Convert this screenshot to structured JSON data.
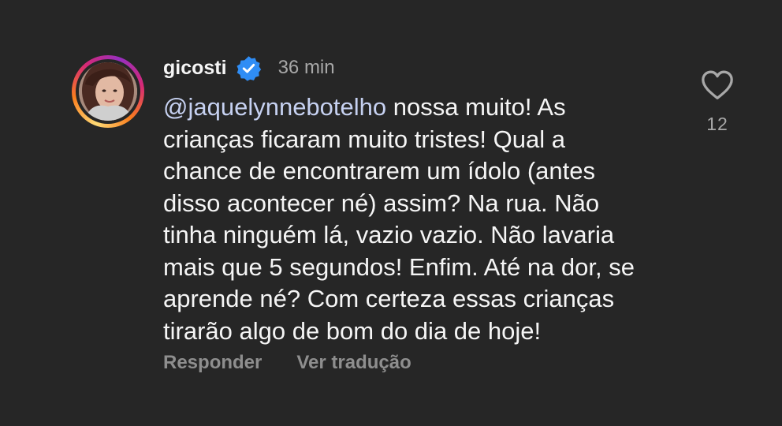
{
  "comment": {
    "username": "gicosti",
    "verified_icon": "verified-badge-icon",
    "timestamp": "36 min",
    "mention": "@jaquelynnebotelho",
    "text": " nossa muito! As\ncrianças ficaram muito tristes! Qual a\nchance de encontrarem um ídolo (antes\ndisso acontecer né) assim? Na rua. Não\ntinha ninguém lá, vazio vazio. Não lavaria\nmais que 5 segundos! Enfim. Até na dor, se\naprende né? Com certeza essas crianças\ntirarão algo de bom do dia de hoje!",
    "reply_label": "Responder",
    "translate_label": "Ver tradução",
    "like_icon": "heart-outline-icon",
    "like_count": "12"
  },
  "colors": {
    "background": "#262626",
    "text": "#f5f5f5",
    "muted": "#a8a8a8",
    "action": "#8e8e8e",
    "mention": "#c6d1f1",
    "verified": "#2f8df5"
  }
}
